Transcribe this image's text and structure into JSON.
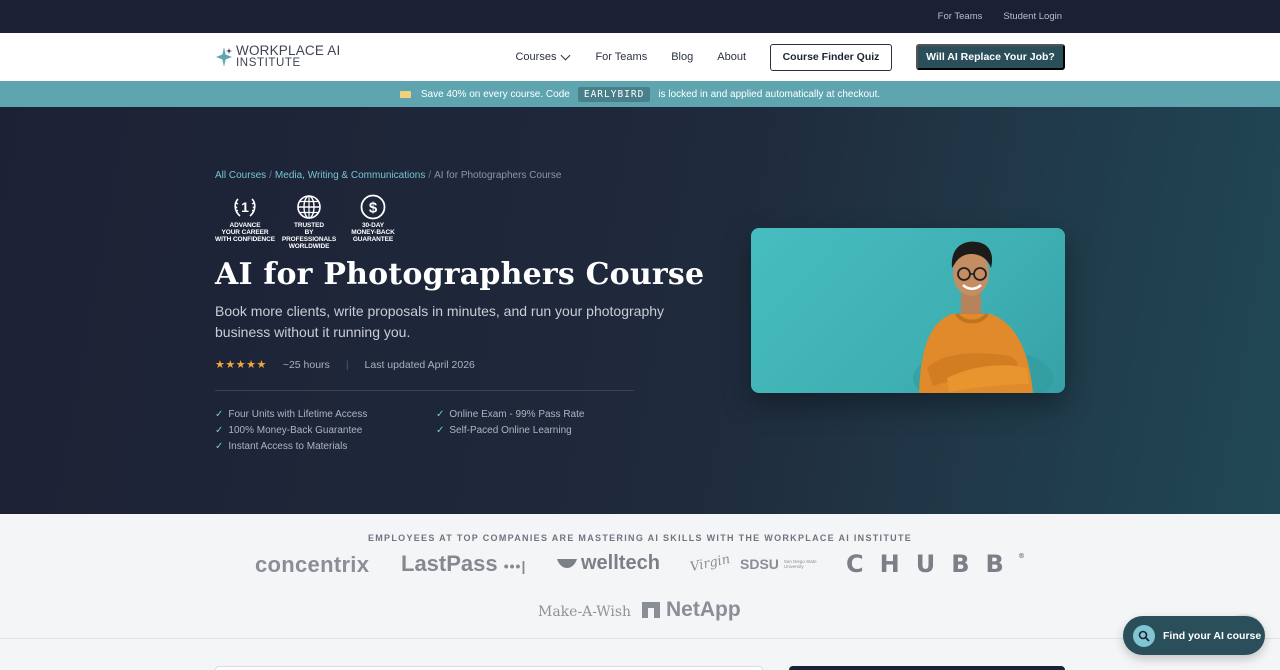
{
  "utility": {
    "for_teams": "For Teams",
    "student_login": "Student Login"
  },
  "brand": {
    "line1": "WORKPLACE AI",
    "line2": "INSTITUTE"
  },
  "nav": {
    "courses": "Courses",
    "for_teams": "For Teams",
    "blog": "Blog",
    "about": "About",
    "quiz": "Course Finder Quiz",
    "cta": "Will AI Replace Your Job?"
  },
  "promo": {
    "before": "Save 40% on every course. Code",
    "code": "EARLYBIRD",
    "after": "is locked in and applied automatically at checkout."
  },
  "breadcrumb": {
    "items": [
      "All Courses",
      "Media, Writing & Communications",
      "AI for Photographers Course"
    ],
    "sep": "/"
  },
  "badges": [
    {
      "icon": "number-one-laurel-icon",
      "lines": [
        "ADVANCE",
        "YOUR CAREER",
        "WITH CONFIDENCE"
      ]
    },
    {
      "icon": "globe-icon",
      "lines": [
        "TRUSTED",
        "BY PROFESSIONALS",
        "WORLDWIDE"
      ]
    },
    {
      "icon": "dollar-icon",
      "lines": [
        "30-DAY",
        "MONEY-BACK",
        "GUARANTEE"
      ]
    }
  ],
  "hero": {
    "title": "AI for Photographers Course",
    "subtitle": "Book more clients, write proposals in minutes, and run your photography business without it running you.",
    "stars": "★★★★★",
    "rating": 5,
    "duration": "~25 hours",
    "divider": "|",
    "updated": "Last updated April 2026",
    "features": [
      "Four Units with Lifetime Access",
      "Online Exam - 99% Pass Rate",
      "100% Money-Back Guarantee",
      "Self-Paced Online Learning",
      "Instant Access to Materials"
    ],
    "check": "✓"
  },
  "companies": {
    "heading": "EMPLOYEES AT TOP COMPANIES ARE MASTERING AI SKILLS WITH THE WORKPLACE AI INSTITUTE",
    "names": [
      "concentrix",
      "LastPass",
      "•••|",
      "welltech",
      "Virgin",
      "SDSU",
      "San Diego State University",
      "CHUBB",
      "®",
      "Make-A-Wish",
      "NetApp"
    ]
  },
  "chat": {
    "label": "Find your AI course",
    "icon": "search-icon"
  },
  "colors": {
    "accent": "#76c4d4",
    "dark": "#1d2135",
    "teal": "#2a4f5b",
    "promo": "#5ea5b0",
    "star": "#f2a93b"
  }
}
